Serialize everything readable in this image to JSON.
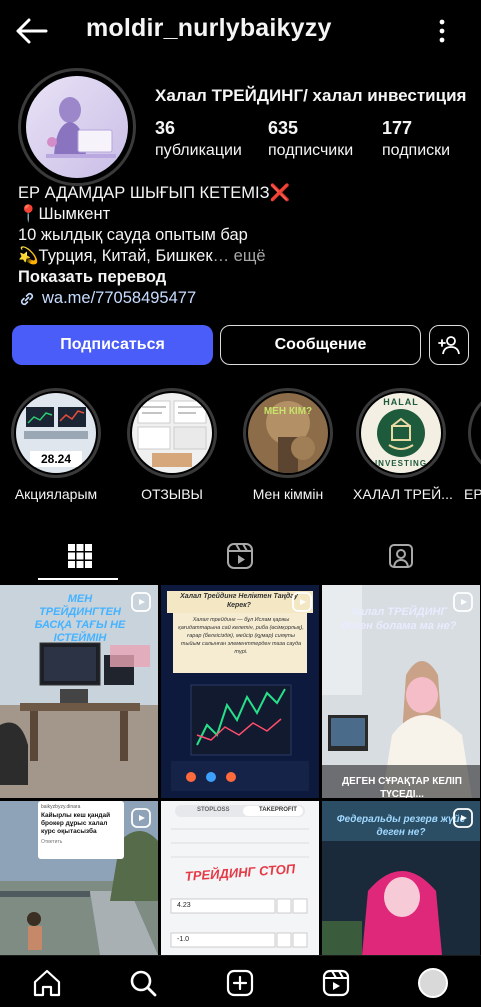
{
  "header": {
    "username": "moldir_nurlybaikyzy"
  },
  "profile": {
    "name": "Халал ТРЕЙДИНГ/ халал инвестиция",
    "stats": [
      {
        "value": "36",
        "label": "публикации"
      },
      {
        "value": "635",
        "label": "подписчики"
      },
      {
        "value": "177",
        "label": "подписки"
      }
    ]
  },
  "bio": {
    "line1": "ЕР АДАМДАР ШЫҒЫП КЕТЕМІЗ❌",
    "line2": "📍Шымкент",
    "line3": "10 жылдық сауда опытым бар",
    "line4": "💫Турция, Китай, Бишкек",
    "more": "… ещё",
    "translate": "Показать перевод",
    "link": "wa.me/77058495477"
  },
  "actions": {
    "follow": "Подписаться",
    "message": "Сообщение"
  },
  "highlights": [
    {
      "label": "Акцияларым",
      "badge": "28.24"
    },
    {
      "label": "ОТЗЫВЫ"
    },
    {
      "label": "Мен кіммін",
      "overlay": "МЕН КІМ?"
    },
    {
      "label": "ХАЛАЛ ТРЕЙ...",
      "logo_top": "HALAL",
      "logo_bottom": "INVESTING"
    },
    {
      "label": "ЕР"
    }
  ],
  "posts": [
    {
      "caption": "МЕН ТРЕЙДИНГТЕН БАСҚА ТАҒЫ НЕ ІСТЕЙМІН"
    },
    {
      "caption": "Халал Трейдинг  Неліктен Таңдау Керек?",
      "body": "Халал трейдинг — бұл Ислам қаржы қағидаттарына сай келетін, риба (өсімқорлық), ғарар (белгісіздік), мейсір (құмар) сияқты тыйым салынған элементтерден таза сауда түрі."
    },
    {
      "caption": "Халал ТРЕЙДИНГ деген болама ма не?",
      "subtitle": "ДЕГЕН СҰРАҚТАР КЕЛІП ТҮСЕДІ..."
    },
    {
      "account": "baikyzbyzy.dinara",
      "caption": "Кайырлы кеш қандай брокер дұрыс халал курс оқытасызба",
      "reply": "Ответить"
    },
    {
      "caption": "ТРЕЙДИНГ СТОП",
      "tab1": "STOPLOSS",
      "tab2": "TAKEPROFIT",
      "field1": "4.23",
      "field2": "-1.0"
    },
    {
      "caption": "Федеральды резерв жүйе деген не?"
    }
  ],
  "colors": {
    "accent": "#4a5df9",
    "background": "#000000",
    "link": "#c7ddff",
    "stop": "#e63946"
  },
  "nav": [
    "home-icon",
    "search-icon",
    "create-icon",
    "reels-icon",
    "profile-avatar"
  ]
}
